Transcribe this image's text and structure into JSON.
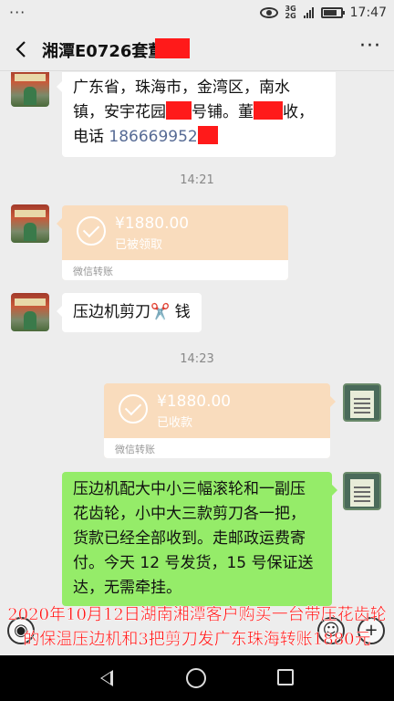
{
  "status_bar": {
    "notification_dots": "···",
    "network_top": "3G",
    "network_bottom": "2G",
    "time": "17:47"
  },
  "header": {
    "title": "湘潭E0726套董"
  },
  "messages": {
    "address": {
      "line1": "广东省，珠海市，金湾区，南水",
      "line2_a": "镇，安宇花园",
      "line2_b": "号铺。董",
      "line2_c": "收，",
      "line3_a": "电话 ",
      "phone": "186669952"
    },
    "time1": "14:21",
    "transfer1": {
      "amount": "¥1880.00",
      "status": "已被领取",
      "footer": "微信转账"
    },
    "scissors_msg": "压边机剪刀✂️ 钱",
    "time2": "14:23",
    "transfer2": {
      "amount": "¥1880.00",
      "status": "已收款",
      "footer": "微信转账"
    },
    "reply": {
      "line1": "压边机配大中小三幅滚轮和一副压",
      "line2": "花齿轮，小中大三款剪刀各一把，",
      "line3": "货款已经全部收到。走邮政运费寄",
      "line4": "付。今天 12 号发货，15 号保证送",
      "line5": "达，无需牵挂。"
    }
  },
  "caption": {
    "line1": "2020年10月12日湖南湘潭客户购买一台带压花齿轮",
    "line2": "的保温压边机和3把剪刀发广东珠海转账1880元"
  },
  "icons": {
    "voice": "voice-icon",
    "emoji": "emoji-icon",
    "plus": "plus-icon"
  },
  "colors": {
    "bubble_green": "#95ec69",
    "transfer_orange": "#f9dcbd",
    "redaction": "#ff1a1a",
    "caption": "#ff1010"
  }
}
